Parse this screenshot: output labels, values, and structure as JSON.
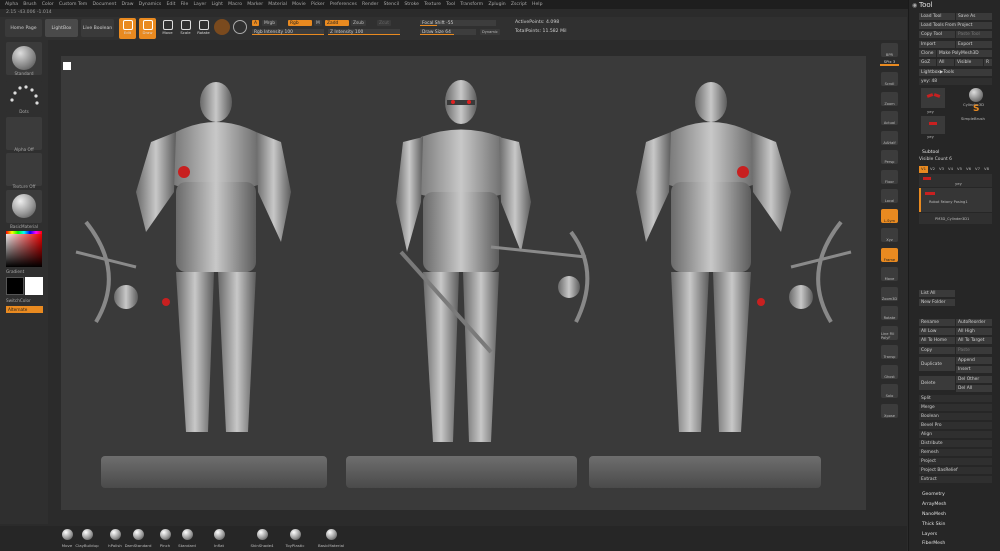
{
  "menu": [
    "Alpha",
    "Brush",
    "Color",
    "Custom Tem",
    "Document",
    "Draw",
    "Dynamics",
    "Edit",
    "File",
    "Layer",
    "Light",
    "Macro",
    "Marker",
    "Material",
    "Movie",
    "Picker",
    "Preferences",
    "Render",
    "Stencil",
    "Stroke",
    "Texture",
    "Tool",
    "Transform",
    "Zplugin",
    "Zscript",
    "Help"
  ],
  "coords": "2.15 -43.006 -1.014",
  "header": {
    "home_page": "Home Page",
    "lightbox": "LightBox",
    "live_boolean": "Live Boolean",
    "tools": [
      "Edit",
      "Draw",
      "Move",
      "Scale",
      "Rotate"
    ],
    "a_label": "A",
    "mrgb": "Mrgb",
    "rgb": "Rgb",
    "m": "M",
    "zadd": "Zadd",
    "zsub": "Zsub",
    "zcut": "Zcut",
    "rgb_intensity": "Rgb Intensity 100",
    "z_intensity": "Z Intensity 100",
    "focal_shift": "Focal Shift -55",
    "draw_size": "Draw Size 64",
    "dynamic": "Dynamic",
    "active_points": "ActivePoints: 4.098",
    "total_points": "TotalPoints: 11.582 Mil"
  },
  "left": {
    "brush_label": "Standard",
    "stroke_label": "Dots",
    "alpha_label": "Alpha Off",
    "texture_label": "Texture Off",
    "material_label": "BasicMaterial",
    "gradient_label": "Gradient",
    "switch_label": "SwitchColor",
    "alternate_label": "Alternate"
  },
  "rightbar": {
    "bpr": "BPR",
    "spix": "SPix 3",
    "buttons": [
      "Scroll",
      "Zoom",
      "Actual",
      "AAHalf",
      "Persp",
      "Floor",
      "Local",
      "L.Sym",
      "Xyz",
      "Frame",
      "Move",
      "Zoom3D",
      "Rotate",
      "Line Fill PolyF",
      "Transp",
      "Ghost",
      "Solo",
      "Xpose"
    ]
  },
  "tool": {
    "title": "Tool",
    "load_tool": "Load Tool",
    "save_as": "Save As",
    "load_tools_from_project": "Load Tools From Project",
    "copy_tool": "Copy Tool",
    "paste_tool": "Paste Tool",
    "import": "Import",
    "export": "Export",
    "clone": "Clone",
    "make_polymesh": "Make PolyMesh3D",
    "goz": "GoZ",
    "all": "All",
    "visible": "Visible",
    "r": "R",
    "lightbox_tools": "Lightbox▶Tools",
    "current_tool": "yey: 48",
    "thumb1": "yey",
    "thumb2": "Cylinder3D",
    "thumb3": "yey",
    "thumb4": "SimpleBrush",
    "thumb5": "yey",
    "subtool": "Subtool",
    "visible_count": "Visible Count 6",
    "versions": [
      "V1",
      "V2",
      "V3",
      "V4",
      "V5",
      "V6",
      "V7",
      "V8"
    ],
    "sub_items": [
      "yey",
      "Robot Fatany Posing1",
      "PM3D_Cylinder3D1"
    ],
    "list_all": "List All",
    "new_folder": "New Folder",
    "rename": "Rename",
    "autoreorder": "AutoReorder",
    "all_low": "All Low",
    "all_high": "All High",
    "all_to_home": "All To Home",
    "all_to_target": "All To Target",
    "copy": "Copy",
    "paste": "Paste",
    "duplicate": "Duplicate",
    "append": "Append",
    "insert": "Insert",
    "delete": "Delete",
    "del_other": "Del Other",
    "del_all": "Del All",
    "actions": [
      "Split",
      "Merge",
      "Boolean",
      "Bevel Pro",
      "Align",
      "Distribute",
      "Remesh",
      "Project",
      "Project BasRelief",
      "Extract"
    ],
    "sections": [
      "Geometry",
      "ArrayMesh",
      "NanoMesh",
      "Thick Skin",
      "Layers",
      "FiberMesh"
    ]
  },
  "brushes": [
    "Move",
    "ClayBuildup",
    "hPolish",
    "DamStandard",
    "Pinch",
    "Standard",
    "Inflat",
    "SkinShade4",
    "ToyPlastic",
    "BasicMaterial"
  ]
}
